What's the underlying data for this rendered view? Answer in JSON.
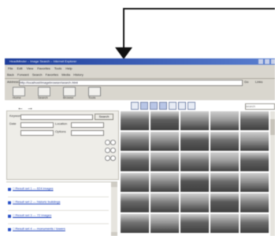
{
  "callout": {
    "color": "#111111"
  },
  "window": {
    "title": "HeadMinder – Image Search – Internet Explorer",
    "menu": [
      "File",
      "Edit",
      "View",
      "Favorites",
      "Tools",
      "Help"
    ],
    "std_toolbar": [
      "Back",
      "Forward",
      "Search",
      "Favorites",
      "Media",
      "History"
    ],
    "address_label": "Address",
    "address_value": "http://localhost/imagebrowser/search.html",
    "go_label": "Go",
    "links_label": "Links"
  },
  "app_toolbar": {
    "buttons": [
      {
        "icon": "home-icon",
        "label": "Home"
      },
      {
        "icon": "search-icon",
        "label": "Search"
      },
      {
        "icon": "browse-icon",
        "label": "Browse"
      },
      {
        "icon": "tools-icon",
        "label": "Tools"
      }
    ]
  },
  "left": {
    "nav": "← →",
    "form": {
      "keyword_label": "Keyword",
      "search_button": "Search",
      "date_label": "Date",
      "location_label": "Location",
      "options_label": "Options"
    },
    "results": [
      {
        "text": "□ Result set 1 — 624 images"
      },
      {
        "text": "□ Result set 2 — historic buildings"
      },
      {
        "text": "□ Result set 3 — 72 images"
      },
      {
        "text": "□ Result set 4 — monuments / towers"
      }
    ]
  },
  "right": {
    "view_buttons": [
      "view-1",
      "view-2",
      "view-3",
      "view-4",
      "view-5",
      "view-6",
      "view-7"
    ],
    "search_placeholder": "search",
    "thumbnails": [
      "#6f6f6f",
      "#5e5e5e",
      "#8a8a8a",
      "#9a9a9a",
      "#6b6b6b",
      "#7c7c7c",
      "#8e8e8e",
      "#5a5a5a",
      "#707070",
      "#949494",
      "#666666",
      "#858585",
      "#777777",
      "#9c9c9c",
      "#606060",
      "#7a7a7a",
      "#8b8b8b",
      "#545454",
      "#6d6d6d",
      "#929292",
      "#686868",
      "#7f7f7f",
      "#909090",
      "#595959",
      "#838383",
      "#747474",
      "#969696",
      "#616161",
      "#888888",
      "#6e6e6e"
    ]
  }
}
